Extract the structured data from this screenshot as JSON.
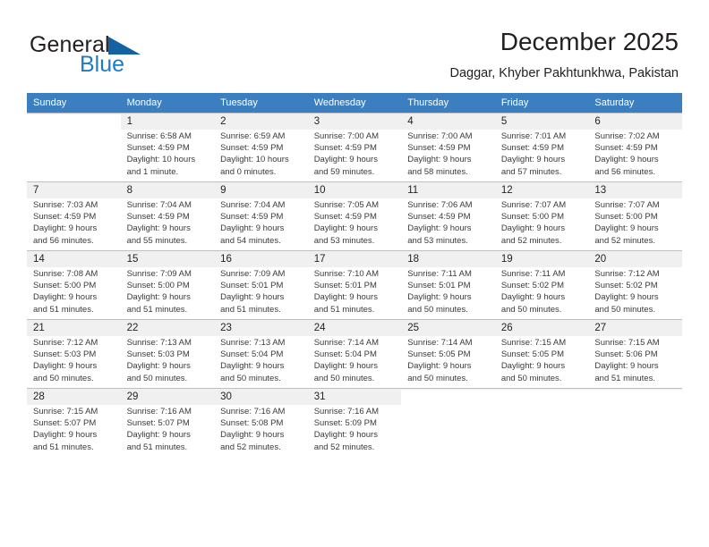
{
  "brand": {
    "name_part1": "General",
    "name_part2": "Blue",
    "accent_color": "#1d7cc4",
    "triangle_color": "#1362a4"
  },
  "header": {
    "title": "December 2025",
    "subtitle": "Daggar, Khyber Pakhtunkhwa, Pakistan"
  },
  "calendar": {
    "header_bg": "#3c7fc1",
    "weekday_headers": [
      "Sunday",
      "Monday",
      "Tuesday",
      "Wednesday",
      "Thursday",
      "Friday",
      "Saturday"
    ],
    "weeks": [
      [
        {
          "day": "",
          "sunrise": "",
          "sunset": "",
          "daylight1": "",
          "daylight2": ""
        },
        {
          "day": "1",
          "sunrise": "Sunrise: 6:58 AM",
          "sunset": "Sunset: 4:59 PM",
          "daylight1": "Daylight: 10 hours",
          "daylight2": "and 1 minute."
        },
        {
          "day": "2",
          "sunrise": "Sunrise: 6:59 AM",
          "sunset": "Sunset: 4:59 PM",
          "daylight1": "Daylight: 10 hours",
          "daylight2": "and 0 minutes."
        },
        {
          "day": "3",
          "sunrise": "Sunrise: 7:00 AM",
          "sunset": "Sunset: 4:59 PM",
          "daylight1": "Daylight: 9 hours",
          "daylight2": "and 59 minutes."
        },
        {
          "day": "4",
          "sunrise": "Sunrise: 7:00 AM",
          "sunset": "Sunset: 4:59 PM",
          "daylight1": "Daylight: 9 hours",
          "daylight2": "and 58 minutes."
        },
        {
          "day": "5",
          "sunrise": "Sunrise: 7:01 AM",
          "sunset": "Sunset: 4:59 PM",
          "daylight1": "Daylight: 9 hours",
          "daylight2": "and 57 minutes."
        },
        {
          "day": "6",
          "sunrise": "Sunrise: 7:02 AM",
          "sunset": "Sunset: 4:59 PM",
          "daylight1": "Daylight: 9 hours",
          "daylight2": "and 56 minutes."
        }
      ],
      [
        {
          "day": "7",
          "sunrise": "Sunrise: 7:03 AM",
          "sunset": "Sunset: 4:59 PM",
          "daylight1": "Daylight: 9 hours",
          "daylight2": "and 56 minutes."
        },
        {
          "day": "8",
          "sunrise": "Sunrise: 7:04 AM",
          "sunset": "Sunset: 4:59 PM",
          "daylight1": "Daylight: 9 hours",
          "daylight2": "and 55 minutes."
        },
        {
          "day": "9",
          "sunrise": "Sunrise: 7:04 AM",
          "sunset": "Sunset: 4:59 PM",
          "daylight1": "Daylight: 9 hours",
          "daylight2": "and 54 minutes."
        },
        {
          "day": "10",
          "sunrise": "Sunrise: 7:05 AM",
          "sunset": "Sunset: 4:59 PM",
          "daylight1": "Daylight: 9 hours",
          "daylight2": "and 53 minutes."
        },
        {
          "day": "11",
          "sunrise": "Sunrise: 7:06 AM",
          "sunset": "Sunset: 4:59 PM",
          "daylight1": "Daylight: 9 hours",
          "daylight2": "and 53 minutes."
        },
        {
          "day": "12",
          "sunrise": "Sunrise: 7:07 AM",
          "sunset": "Sunset: 5:00 PM",
          "daylight1": "Daylight: 9 hours",
          "daylight2": "and 52 minutes."
        },
        {
          "day": "13",
          "sunrise": "Sunrise: 7:07 AM",
          "sunset": "Sunset: 5:00 PM",
          "daylight1": "Daylight: 9 hours",
          "daylight2": "and 52 minutes."
        }
      ],
      [
        {
          "day": "14",
          "sunrise": "Sunrise: 7:08 AM",
          "sunset": "Sunset: 5:00 PM",
          "daylight1": "Daylight: 9 hours",
          "daylight2": "and 51 minutes."
        },
        {
          "day": "15",
          "sunrise": "Sunrise: 7:09 AM",
          "sunset": "Sunset: 5:00 PM",
          "daylight1": "Daylight: 9 hours",
          "daylight2": "and 51 minutes."
        },
        {
          "day": "16",
          "sunrise": "Sunrise: 7:09 AM",
          "sunset": "Sunset: 5:01 PM",
          "daylight1": "Daylight: 9 hours",
          "daylight2": "and 51 minutes."
        },
        {
          "day": "17",
          "sunrise": "Sunrise: 7:10 AM",
          "sunset": "Sunset: 5:01 PM",
          "daylight1": "Daylight: 9 hours",
          "daylight2": "and 51 minutes."
        },
        {
          "day": "18",
          "sunrise": "Sunrise: 7:11 AM",
          "sunset": "Sunset: 5:01 PM",
          "daylight1": "Daylight: 9 hours",
          "daylight2": "and 50 minutes."
        },
        {
          "day": "19",
          "sunrise": "Sunrise: 7:11 AM",
          "sunset": "Sunset: 5:02 PM",
          "daylight1": "Daylight: 9 hours",
          "daylight2": "and 50 minutes."
        },
        {
          "day": "20",
          "sunrise": "Sunrise: 7:12 AM",
          "sunset": "Sunset: 5:02 PM",
          "daylight1": "Daylight: 9 hours",
          "daylight2": "and 50 minutes."
        }
      ],
      [
        {
          "day": "21",
          "sunrise": "Sunrise: 7:12 AM",
          "sunset": "Sunset: 5:03 PM",
          "daylight1": "Daylight: 9 hours",
          "daylight2": "and 50 minutes."
        },
        {
          "day": "22",
          "sunrise": "Sunrise: 7:13 AM",
          "sunset": "Sunset: 5:03 PM",
          "daylight1": "Daylight: 9 hours",
          "daylight2": "and 50 minutes."
        },
        {
          "day": "23",
          "sunrise": "Sunrise: 7:13 AM",
          "sunset": "Sunset: 5:04 PM",
          "daylight1": "Daylight: 9 hours",
          "daylight2": "and 50 minutes."
        },
        {
          "day": "24",
          "sunrise": "Sunrise: 7:14 AM",
          "sunset": "Sunset: 5:04 PM",
          "daylight1": "Daylight: 9 hours",
          "daylight2": "and 50 minutes."
        },
        {
          "day": "25",
          "sunrise": "Sunrise: 7:14 AM",
          "sunset": "Sunset: 5:05 PM",
          "daylight1": "Daylight: 9 hours",
          "daylight2": "and 50 minutes."
        },
        {
          "day": "26",
          "sunrise": "Sunrise: 7:15 AM",
          "sunset": "Sunset: 5:05 PM",
          "daylight1": "Daylight: 9 hours",
          "daylight2": "and 50 minutes."
        },
        {
          "day": "27",
          "sunrise": "Sunrise: 7:15 AM",
          "sunset": "Sunset: 5:06 PM",
          "daylight1": "Daylight: 9 hours",
          "daylight2": "and 51 minutes."
        }
      ],
      [
        {
          "day": "28",
          "sunrise": "Sunrise: 7:15 AM",
          "sunset": "Sunset: 5:07 PM",
          "daylight1": "Daylight: 9 hours",
          "daylight2": "and 51 minutes."
        },
        {
          "day": "29",
          "sunrise": "Sunrise: 7:16 AM",
          "sunset": "Sunset: 5:07 PM",
          "daylight1": "Daylight: 9 hours",
          "daylight2": "and 51 minutes."
        },
        {
          "day": "30",
          "sunrise": "Sunrise: 7:16 AM",
          "sunset": "Sunset: 5:08 PM",
          "daylight1": "Daylight: 9 hours",
          "daylight2": "and 52 minutes."
        },
        {
          "day": "31",
          "sunrise": "Sunrise: 7:16 AM",
          "sunset": "Sunset: 5:09 PM",
          "daylight1": "Daylight: 9 hours",
          "daylight2": "and 52 minutes."
        },
        {
          "day": "",
          "sunrise": "",
          "sunset": "",
          "daylight1": "",
          "daylight2": ""
        },
        {
          "day": "",
          "sunrise": "",
          "sunset": "",
          "daylight1": "",
          "daylight2": ""
        },
        {
          "day": "",
          "sunrise": "",
          "sunset": "",
          "daylight1": "",
          "daylight2": ""
        }
      ]
    ]
  }
}
